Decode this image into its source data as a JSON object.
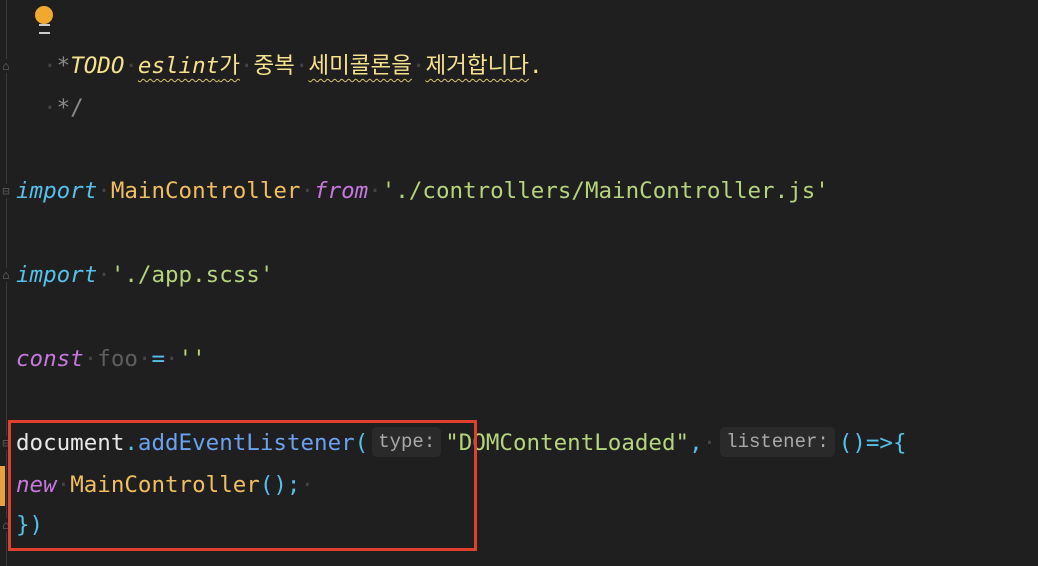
{
  "editor": {
    "lines": {
      "comment_todo": {
        "prefix": "*",
        "todo_keyword": "TODO",
        "eslint": "eslint",
        "ga": "가",
        "word_duplicate": "중복",
        "word_semicolon": "세미콜론을",
        "word_remove": "제거합니다",
        "period": "."
      },
      "comment_end": {
        "text": "*/"
      },
      "import_main": {
        "keyword": "import",
        "identifier": "MainController",
        "from": "from",
        "path": "'./controllers/MainController.js'"
      },
      "import_scss": {
        "keyword": "import",
        "path": "'./app.scss'"
      },
      "const_foo": {
        "keyword": "const",
        "name": "foo",
        "op": "=",
        "value": "''"
      },
      "listener": {
        "object": "document",
        "dot": ".",
        "method": "addEventListener",
        "open_paren": "(",
        "hint_type": "type:",
        "event": "\"DOMContentLoaded\"",
        "comma": ",",
        "hint_listener": "listener:",
        "arrow": "()=>{"
      },
      "new_controller": {
        "keyword": "new",
        "class": "MainController",
        "call": "();"
      },
      "close": {
        "text": "})"
      }
    },
    "lightbulb_icon": "lightbulb-icon",
    "accent_colors": {
      "highlight_box": "#e0412c",
      "modified_bar": "#e9a23b",
      "lightbulb": "#f0a92d"
    }
  }
}
